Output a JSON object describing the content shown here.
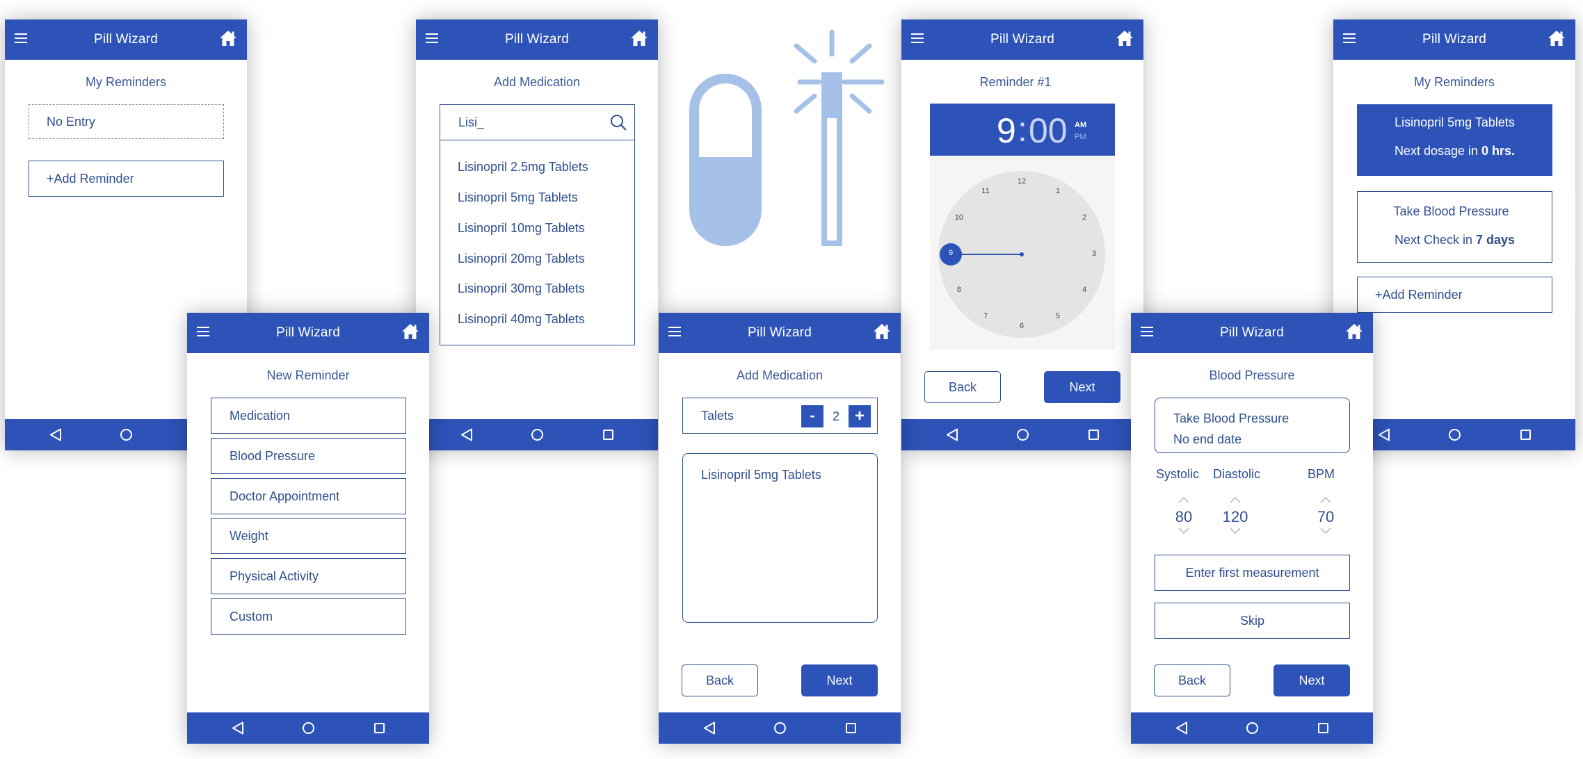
{
  "app": {
    "title": "Pill Wizard"
  },
  "colors": {
    "primary": "#2d53b9",
    "text": "#2f4f8f",
    "logo": "#a6c1e8"
  },
  "screen1": {
    "heading": "My Reminders",
    "empty_entry": "No Entry",
    "add_reminder": "+Add Reminder"
  },
  "screen2": {
    "heading": "New Reminder",
    "options": [
      "Medication",
      "Blood Pressure",
      "Doctor Appointment",
      "Weight",
      "Physical Activity",
      "Custom"
    ]
  },
  "screen3": {
    "heading": "Add Medication",
    "search_value": "Lisi_",
    "results": [
      "Lisinopril 2.5mg Tablets",
      "Lisinopril 5mg Tablets",
      "Lisinopril 10mg Tablets",
      "Lisinopril 20mg Tablets",
      "Lisinopril 30mg Tablets",
      "Lisinopril 40mg Tablets"
    ]
  },
  "screen4": {
    "heading": "Add Medication",
    "dose_unit": "Talets",
    "minus": "-",
    "quantity": "2",
    "plus": "+",
    "selected_med": "Lisinopril 5mg Tablets",
    "back": "Back",
    "next": "Next"
  },
  "screen5": {
    "heading": "Reminder #1",
    "time_hour": "9",
    "time_sep": ":",
    "time_min": "00",
    "am": "AM",
    "pm": "PM",
    "selected_hour": "9",
    "back": "Back",
    "next": "Next"
  },
  "screen6": {
    "heading": "Blood Pressure",
    "card_line1": "Take Blood Pressure",
    "card_line2": "No end date",
    "labels": {
      "systolic": "Systolic",
      "diastolic": "Diastolic",
      "bpm": "BPM"
    },
    "values": {
      "systolic": "80",
      "diastolic": "120",
      "bpm": "70"
    },
    "enter_first": "Enter first measurement",
    "skip": "Skip",
    "back": "Back",
    "next": "Next"
  },
  "screen7": {
    "heading": "My Reminders",
    "med_reminder": {
      "title": "Lisinopril 5mg Tablets",
      "next_prefix": "Next dosage in ",
      "next_value": "0 hrs."
    },
    "bp_reminder": {
      "title": "Take Blood Pressure",
      "next_prefix": "Next Check in ",
      "next_value": "7 days"
    },
    "add_reminder": "+Add Reminder"
  }
}
